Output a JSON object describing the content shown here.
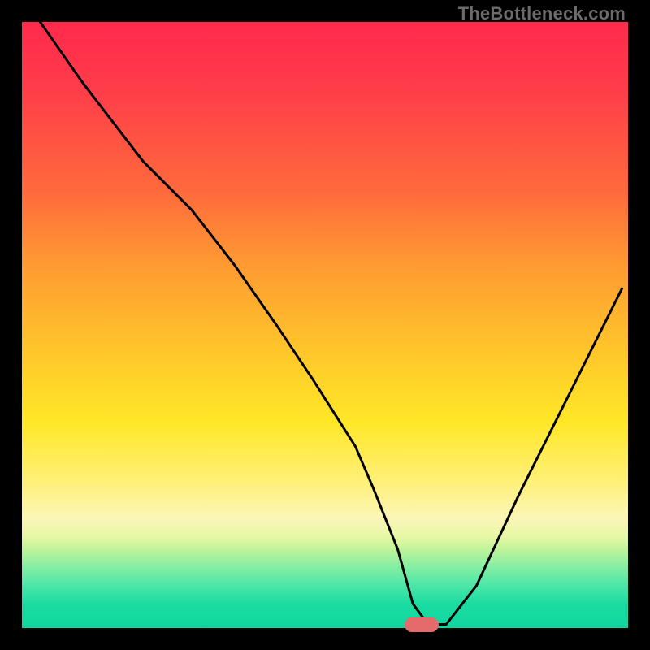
{
  "watermark": "TheBottleneck.com",
  "colors": {
    "background": "#000000",
    "gradient_top": "#ff2a4d",
    "gradient_bottom": "#0fd79e",
    "curve_stroke": "#000000",
    "marker_fill": "#e46a6c"
  },
  "chart_data": {
    "type": "line",
    "title": "",
    "xlabel": "",
    "ylabel": "",
    "xlim": [
      0,
      100
    ],
    "ylim": [
      0,
      100
    ],
    "grid": false,
    "legend": false,
    "series": [
      {
        "name": "bottleneck-curve",
        "x": [
          3,
          10,
          20,
          28,
          35,
          42,
          48,
          55,
          58,
          62,
          64.5,
          67,
          70,
          75,
          82,
          90,
          99
        ],
        "y": [
          100,
          90,
          77,
          69,
          60,
          50,
          41,
          30,
          23,
          13,
          4,
          0.6,
          0.6,
          7,
          22,
          38,
          56
        ]
      }
    ],
    "marker": {
      "name": "optimal-range",
      "x_center": 66,
      "y": 0.6,
      "width_pct": 5.6
    },
    "note": "x/y are percentages of plot width/height; y measured from bottom; curve values read off image to nearest ~1%"
  }
}
